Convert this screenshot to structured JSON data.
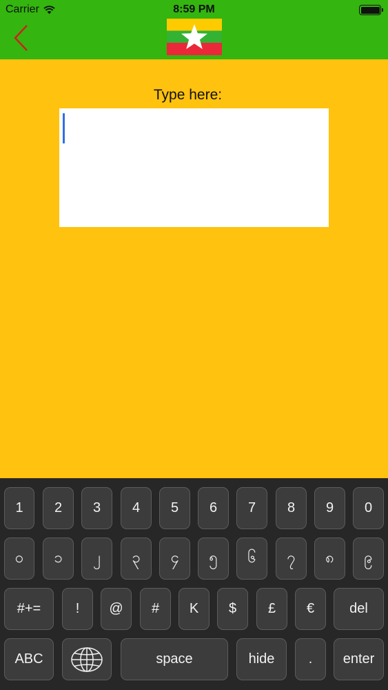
{
  "status_bar": {
    "carrier": "Carrier",
    "time": "8:59 PM",
    "wifi_icon": "wifi-icon",
    "battery_icon": "battery-icon"
  },
  "nav": {
    "back_icon": "chevron-left-icon",
    "flag_icon": "myanmar-flag-icon",
    "back_color": "#D01F1F",
    "header_color": "#34B50F"
  },
  "main": {
    "prompt": "Type here:",
    "text_value": "",
    "background_color": "#FFC20E"
  },
  "keyboard": {
    "row1": [
      "1",
      "2",
      "3",
      "4",
      "5",
      "6",
      "7",
      "8",
      "9",
      "0"
    ],
    "row2": [
      "၀",
      "၁",
      "၂",
      "၃",
      "၄",
      "၅",
      "၆",
      "၇",
      "၈",
      "၉"
    ],
    "row3": [
      "#+=",
      "!",
      "@",
      "#",
      "K",
      "$",
      "£",
      "€",
      "del"
    ],
    "row4": [
      "ABC",
      "globe-icon",
      "space",
      "hide",
      ".",
      "enter"
    ]
  }
}
